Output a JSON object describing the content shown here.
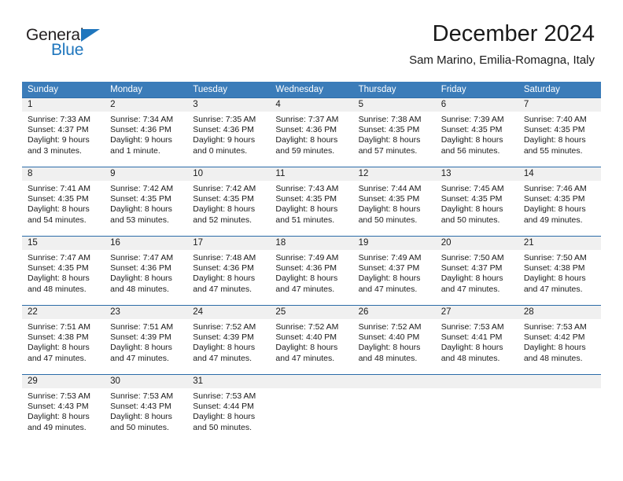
{
  "brand": {
    "name_top": "General",
    "name_bottom": "Blue",
    "accent_color": "#1f76bd",
    "dark_color": "#231f20"
  },
  "header": {
    "title": "December 2024",
    "subtitle": "Sam Marino, Emilia-Romagna, Italy"
  },
  "calendar": {
    "header_background": "#3b7cb9",
    "row_divider_color": "#2c6ca8",
    "daynum_background": "#f0f0f0",
    "weekdays": [
      "Sunday",
      "Monday",
      "Tuesday",
      "Wednesday",
      "Thursday",
      "Friday",
      "Saturday"
    ],
    "weeks": [
      [
        {
          "day": "1",
          "sunrise": "Sunrise: 7:33 AM",
          "sunset": "Sunset: 4:37 PM",
          "daylight1": "Daylight: 9 hours",
          "daylight2": "and 3 minutes."
        },
        {
          "day": "2",
          "sunrise": "Sunrise: 7:34 AM",
          "sunset": "Sunset: 4:36 PM",
          "daylight1": "Daylight: 9 hours",
          "daylight2": "and 1 minute."
        },
        {
          "day": "3",
          "sunrise": "Sunrise: 7:35 AM",
          "sunset": "Sunset: 4:36 PM",
          "daylight1": "Daylight: 9 hours",
          "daylight2": "and 0 minutes."
        },
        {
          "day": "4",
          "sunrise": "Sunrise: 7:37 AM",
          "sunset": "Sunset: 4:36 PM",
          "daylight1": "Daylight: 8 hours",
          "daylight2": "and 59 minutes."
        },
        {
          "day": "5",
          "sunrise": "Sunrise: 7:38 AM",
          "sunset": "Sunset: 4:35 PM",
          "daylight1": "Daylight: 8 hours",
          "daylight2": "and 57 minutes."
        },
        {
          "day": "6",
          "sunrise": "Sunrise: 7:39 AM",
          "sunset": "Sunset: 4:35 PM",
          "daylight1": "Daylight: 8 hours",
          "daylight2": "and 56 minutes."
        },
        {
          "day": "7",
          "sunrise": "Sunrise: 7:40 AM",
          "sunset": "Sunset: 4:35 PM",
          "daylight1": "Daylight: 8 hours",
          "daylight2": "and 55 minutes."
        }
      ],
      [
        {
          "day": "8",
          "sunrise": "Sunrise: 7:41 AM",
          "sunset": "Sunset: 4:35 PM",
          "daylight1": "Daylight: 8 hours",
          "daylight2": "and 54 minutes."
        },
        {
          "day": "9",
          "sunrise": "Sunrise: 7:42 AM",
          "sunset": "Sunset: 4:35 PM",
          "daylight1": "Daylight: 8 hours",
          "daylight2": "and 53 minutes."
        },
        {
          "day": "10",
          "sunrise": "Sunrise: 7:42 AM",
          "sunset": "Sunset: 4:35 PM",
          "daylight1": "Daylight: 8 hours",
          "daylight2": "and 52 minutes."
        },
        {
          "day": "11",
          "sunrise": "Sunrise: 7:43 AM",
          "sunset": "Sunset: 4:35 PM",
          "daylight1": "Daylight: 8 hours",
          "daylight2": "and 51 minutes."
        },
        {
          "day": "12",
          "sunrise": "Sunrise: 7:44 AM",
          "sunset": "Sunset: 4:35 PM",
          "daylight1": "Daylight: 8 hours",
          "daylight2": "and 50 minutes."
        },
        {
          "day": "13",
          "sunrise": "Sunrise: 7:45 AM",
          "sunset": "Sunset: 4:35 PM",
          "daylight1": "Daylight: 8 hours",
          "daylight2": "and 50 minutes."
        },
        {
          "day": "14",
          "sunrise": "Sunrise: 7:46 AM",
          "sunset": "Sunset: 4:35 PM",
          "daylight1": "Daylight: 8 hours",
          "daylight2": "and 49 minutes."
        }
      ],
      [
        {
          "day": "15",
          "sunrise": "Sunrise: 7:47 AM",
          "sunset": "Sunset: 4:35 PM",
          "daylight1": "Daylight: 8 hours",
          "daylight2": "and 48 minutes."
        },
        {
          "day": "16",
          "sunrise": "Sunrise: 7:47 AM",
          "sunset": "Sunset: 4:36 PM",
          "daylight1": "Daylight: 8 hours",
          "daylight2": "and 48 minutes."
        },
        {
          "day": "17",
          "sunrise": "Sunrise: 7:48 AM",
          "sunset": "Sunset: 4:36 PM",
          "daylight1": "Daylight: 8 hours",
          "daylight2": "and 47 minutes."
        },
        {
          "day": "18",
          "sunrise": "Sunrise: 7:49 AM",
          "sunset": "Sunset: 4:36 PM",
          "daylight1": "Daylight: 8 hours",
          "daylight2": "and 47 minutes."
        },
        {
          "day": "19",
          "sunrise": "Sunrise: 7:49 AM",
          "sunset": "Sunset: 4:37 PM",
          "daylight1": "Daylight: 8 hours",
          "daylight2": "and 47 minutes."
        },
        {
          "day": "20",
          "sunrise": "Sunrise: 7:50 AM",
          "sunset": "Sunset: 4:37 PM",
          "daylight1": "Daylight: 8 hours",
          "daylight2": "and 47 minutes."
        },
        {
          "day": "21",
          "sunrise": "Sunrise: 7:50 AM",
          "sunset": "Sunset: 4:38 PM",
          "daylight1": "Daylight: 8 hours",
          "daylight2": "and 47 minutes."
        }
      ],
      [
        {
          "day": "22",
          "sunrise": "Sunrise: 7:51 AM",
          "sunset": "Sunset: 4:38 PM",
          "daylight1": "Daylight: 8 hours",
          "daylight2": "and 47 minutes."
        },
        {
          "day": "23",
          "sunrise": "Sunrise: 7:51 AM",
          "sunset": "Sunset: 4:39 PM",
          "daylight1": "Daylight: 8 hours",
          "daylight2": "and 47 minutes."
        },
        {
          "day": "24",
          "sunrise": "Sunrise: 7:52 AM",
          "sunset": "Sunset: 4:39 PM",
          "daylight1": "Daylight: 8 hours",
          "daylight2": "and 47 minutes."
        },
        {
          "day": "25",
          "sunrise": "Sunrise: 7:52 AM",
          "sunset": "Sunset: 4:40 PM",
          "daylight1": "Daylight: 8 hours",
          "daylight2": "and 47 minutes."
        },
        {
          "day": "26",
          "sunrise": "Sunrise: 7:52 AM",
          "sunset": "Sunset: 4:40 PM",
          "daylight1": "Daylight: 8 hours",
          "daylight2": "and 48 minutes."
        },
        {
          "day": "27",
          "sunrise": "Sunrise: 7:53 AM",
          "sunset": "Sunset: 4:41 PM",
          "daylight1": "Daylight: 8 hours",
          "daylight2": "and 48 minutes."
        },
        {
          "day": "28",
          "sunrise": "Sunrise: 7:53 AM",
          "sunset": "Sunset: 4:42 PM",
          "daylight1": "Daylight: 8 hours",
          "daylight2": "and 48 minutes."
        }
      ],
      [
        {
          "day": "29",
          "sunrise": "Sunrise: 7:53 AM",
          "sunset": "Sunset: 4:43 PM",
          "daylight1": "Daylight: 8 hours",
          "daylight2": "and 49 minutes."
        },
        {
          "day": "30",
          "sunrise": "Sunrise: 7:53 AM",
          "sunset": "Sunset: 4:43 PM",
          "daylight1": "Daylight: 8 hours",
          "daylight2": "and 50 minutes."
        },
        {
          "day": "31",
          "sunrise": "Sunrise: 7:53 AM",
          "sunset": "Sunset: 4:44 PM",
          "daylight1": "Daylight: 8 hours",
          "daylight2": "and 50 minutes."
        },
        {
          "day": "",
          "sunrise": "",
          "sunset": "",
          "daylight1": "",
          "daylight2": ""
        },
        {
          "day": "",
          "sunrise": "",
          "sunset": "",
          "daylight1": "",
          "daylight2": ""
        },
        {
          "day": "",
          "sunrise": "",
          "sunset": "",
          "daylight1": "",
          "daylight2": ""
        },
        {
          "day": "",
          "sunrise": "",
          "sunset": "",
          "daylight1": "",
          "daylight2": ""
        }
      ]
    ]
  }
}
